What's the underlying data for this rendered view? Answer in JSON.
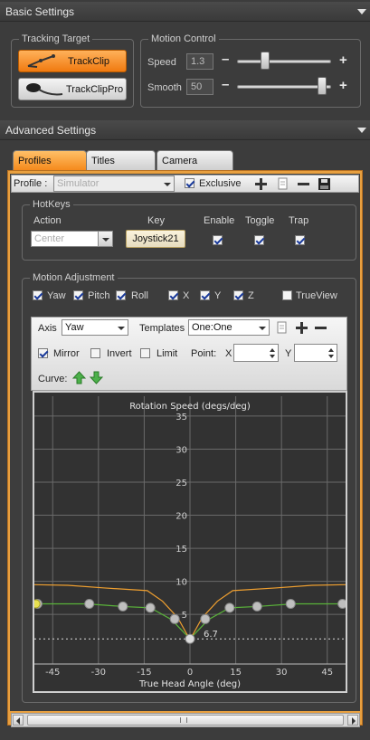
{
  "sections": {
    "basic": "Basic Settings",
    "advanced": "Advanced Settings"
  },
  "tracking_target": {
    "title": "Tracking Target",
    "options": [
      {
        "label": "TrackClip",
        "selected": true
      },
      {
        "label": "TrackClipPro",
        "selected": false
      }
    ]
  },
  "motion_control": {
    "title": "Motion Control",
    "speed": {
      "label": "Speed",
      "value": "1.3",
      "level": 0.28
    },
    "smooth": {
      "label": "Smooth",
      "value": "50",
      "level": 0.95
    }
  },
  "tabs": [
    {
      "label": "Profiles",
      "active": true
    },
    {
      "label": "Titles",
      "active": false
    },
    {
      "label": "Camera",
      "active": false
    }
  ],
  "profile": {
    "label": "Profile :",
    "value": "Simulator",
    "exclusive_label": "Exclusive",
    "exclusive_checked": true
  },
  "hotkeys": {
    "title": "HotKeys",
    "headers": {
      "action": "Action",
      "key": "Key",
      "enable": "Enable",
      "toggle": "Toggle",
      "trap": "Trap"
    },
    "action_placeholder": "Center",
    "key": "Joystick21",
    "enable": true,
    "toggle": true,
    "trap": true
  },
  "motion_adjustment": {
    "title": "Motion Adjustment",
    "axes": [
      {
        "label": "Yaw",
        "checked": true
      },
      {
        "label": "Pitch",
        "checked": true
      },
      {
        "label": "Roll",
        "checked": true
      },
      {
        "label": "X",
        "checked": true
      },
      {
        "label": "Y",
        "checked": true
      },
      {
        "label": "Z",
        "checked": true
      }
    ],
    "trueview": {
      "label": "TrueView",
      "checked": false
    }
  },
  "curve_editor": {
    "axis_label": "Axis",
    "axis_value": "Yaw",
    "templates_label": "Templates",
    "templates_value": "One:One",
    "mirror": {
      "label": "Mirror",
      "checked": true
    },
    "invert": {
      "label": "Invert",
      "checked": false
    },
    "limit": {
      "label": "Limit",
      "checked": false
    },
    "point_label": "Point:",
    "x_label": "X",
    "y_label": "Y",
    "curve_label": "Curve:"
  },
  "chart_data": {
    "type": "line",
    "title": "Rotation Speed (degs/deg)",
    "xlabel": "True Head Angle (deg)",
    "ylabel": "",
    "xlim": [
      -51,
      51
    ],
    "ylim": [
      -2.5,
      38
    ],
    "xticks": [
      -45,
      -30,
      -15,
      0,
      15,
      30,
      45
    ],
    "yticks": [
      5,
      10,
      15,
      20,
      25,
      30,
      35
    ],
    "grid": true,
    "series": [
      {
        "color": "#5ab33a",
        "points": [
          [
            -51,
            6.6
          ],
          [
            -34,
            6.6
          ],
          [
            -22,
            6.2
          ],
          [
            -13,
            6.0
          ],
          [
            -6,
            4.2
          ],
          [
            0,
            1.3
          ],
          [
            6,
            4.2
          ],
          [
            13,
            6.0
          ],
          [
            22,
            6.2
          ],
          [
            34,
            6.6
          ],
          [
            51,
            6.6
          ]
        ]
      },
      {
        "color": "#f0a030",
        "points": [
          [
            -51,
            9.5
          ],
          [
            -40,
            9.4
          ],
          [
            -28,
            9.0
          ],
          [
            -14,
            8.6
          ],
          [
            -9,
            7.0
          ],
          [
            -4,
            4.5
          ],
          [
            -1,
            2.0
          ],
          [
            0,
            1.3
          ],
          [
            1,
            2.0
          ],
          [
            4,
            4.5
          ],
          [
            9,
            7.0
          ],
          [
            14,
            8.6
          ],
          [
            28,
            9.0
          ],
          [
            40,
            9.4
          ],
          [
            51,
            9.5
          ]
        ]
      }
    ],
    "control_points": [
      [
        -50,
        6.6
      ],
      [
        -33,
        6.6
      ],
      [
        -22,
        6.2
      ],
      [
        -13,
        6.0
      ],
      [
        -5,
        4.3
      ],
      [
        0,
        1.3
      ],
      [
        5,
        4.3
      ],
      [
        13,
        6.0
      ],
      [
        22,
        6.2
      ],
      [
        33,
        6.6
      ],
      [
        50,
        6.6
      ]
    ],
    "reference_line": {
      "y": 1.3,
      "label": "6.7"
    }
  },
  "colors": {
    "accent": "#f58a1c",
    "background": "#3c3c3c"
  },
  "icons": [
    "add-icon",
    "copy-icon",
    "minus-icon",
    "save-icon",
    "arrow-up-icon",
    "arrow-down-icon"
  ]
}
